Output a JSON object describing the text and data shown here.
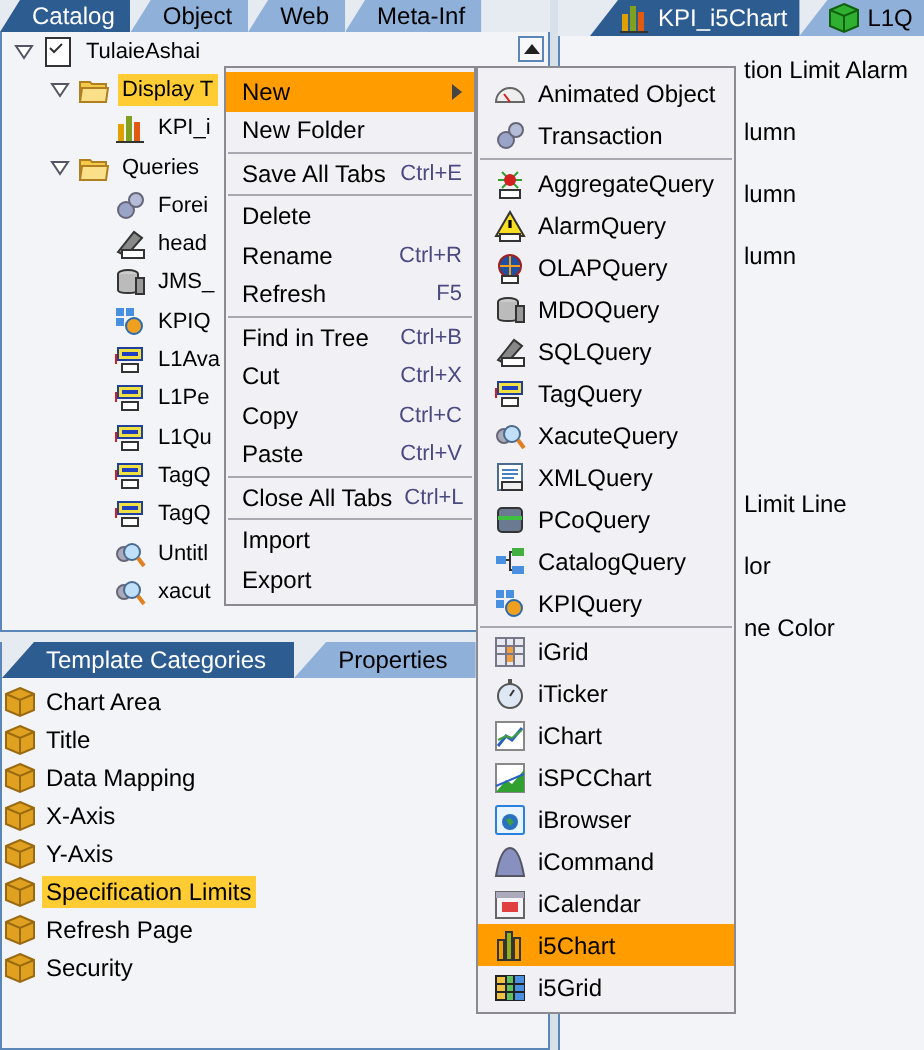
{
  "catalog_tabs": [
    {
      "label": "Catalog",
      "selected": true
    },
    {
      "label": "Object",
      "selected": false
    },
    {
      "label": "Web",
      "selected": false
    },
    {
      "label": "Meta-Inf",
      "selected": false
    }
  ],
  "tree": [
    {
      "label": "TulaieAshai",
      "expanded": true,
      "selected": false,
      "children": [
        {
          "label": "Display T",
          "expanded": true,
          "selected": true,
          "children": [
            {
              "label": "KPI_i",
              "selected": false
            }
          ]
        },
        {
          "label": "Queries",
          "expanded": true,
          "selected": false,
          "children": [
            {
              "label": "Forei",
              "selected": false
            },
            {
              "label": "head",
              "selected": false
            },
            {
              "label": "JMS_",
              "selected": false
            },
            {
              "label": "KPIQ",
              "selected": false
            },
            {
              "label": "L1Ava",
              "selected": false
            },
            {
              "label": "L1Pe",
              "selected": false
            },
            {
              "label": "L1Qu",
              "selected": false
            },
            {
              "label": "TagQ",
              "selected": false
            },
            {
              "label": "TagQ",
              "selected": false
            },
            {
              "label": "Untitl",
              "selected": false
            },
            {
              "label": "xacut",
              "selected": false
            }
          ]
        }
      ]
    }
  ],
  "category_tabs": [
    {
      "label": "Template Categories",
      "selected": true
    },
    {
      "label": "Properties",
      "selected": false
    }
  ],
  "categories": [
    {
      "label": "Chart Area",
      "selected": false
    },
    {
      "label": "Title",
      "selected": false
    },
    {
      "label": "Data Mapping",
      "selected": false
    },
    {
      "label": "X-Axis",
      "selected": false
    },
    {
      "label": "Y-Axis",
      "selected": false
    },
    {
      "label": "Specification Limits",
      "selected": true
    },
    {
      "label": "Refresh Page",
      "selected": false
    },
    {
      "label": "Security",
      "selected": false
    }
  ],
  "editor_tabs": [
    {
      "label": "KPI_i5Chart",
      "selected": true
    },
    {
      "label": "L1Q",
      "selected": false
    }
  ],
  "editor_lines": [
    "tion Limit Alarm",
    "lumn",
    "lumn",
    "lumn",
    "Limit Line",
    "lor",
    "ne Color"
  ],
  "context_menu": [
    {
      "kind": "item",
      "label": "New",
      "selected": true,
      "submenu": true
    },
    {
      "kind": "item",
      "label": "New Folder",
      "selected": false
    },
    {
      "kind": "separator"
    },
    {
      "kind": "item",
      "label": "Save All Tabs",
      "shortcut": "Ctrl+E",
      "selected": false
    },
    {
      "kind": "separator"
    },
    {
      "kind": "item",
      "label": "Delete",
      "selected": false
    },
    {
      "kind": "item",
      "label": "Rename",
      "shortcut": "Ctrl+R",
      "selected": false
    },
    {
      "kind": "item",
      "label": "Refresh",
      "shortcut": "F5",
      "selected": false
    },
    {
      "kind": "separator"
    },
    {
      "kind": "item",
      "label": "Find in Tree",
      "shortcut": "Ctrl+B",
      "selected": false
    },
    {
      "kind": "item",
      "label": "Cut",
      "shortcut": "Ctrl+X",
      "selected": false
    },
    {
      "kind": "item",
      "label": "Copy",
      "shortcut": "Ctrl+C",
      "selected": false
    },
    {
      "kind": "item",
      "label": "Paste",
      "shortcut": "Ctrl+V",
      "selected": false
    },
    {
      "kind": "separator"
    },
    {
      "kind": "item",
      "label": "Close All Tabs",
      "shortcut": "Ctrl+L",
      "selected": false
    },
    {
      "kind": "separator"
    },
    {
      "kind": "item",
      "label": "Import",
      "selected": false
    },
    {
      "kind": "item",
      "label": "Export",
      "selected": false
    }
  ],
  "new_submenu": [
    {
      "kind": "item",
      "label": "Animated Object",
      "selected": false
    },
    {
      "kind": "item",
      "label": "Transaction",
      "selected": false
    },
    {
      "kind": "separator"
    },
    {
      "kind": "item",
      "label": "AggregateQuery",
      "selected": false
    },
    {
      "kind": "item",
      "label": "AlarmQuery",
      "selected": false
    },
    {
      "kind": "item",
      "label": "OLAPQuery",
      "selected": false
    },
    {
      "kind": "item",
      "label": "MDOQuery",
      "selected": false
    },
    {
      "kind": "item",
      "label": "SQLQuery",
      "selected": false
    },
    {
      "kind": "item",
      "label": "TagQuery",
      "selected": false
    },
    {
      "kind": "item",
      "label": "XacuteQuery",
      "selected": false
    },
    {
      "kind": "item",
      "label": "XMLQuery",
      "selected": false
    },
    {
      "kind": "item",
      "label": "PCoQuery",
      "selected": false
    },
    {
      "kind": "item",
      "label": "CatalogQuery",
      "selected": false
    },
    {
      "kind": "item",
      "label": "KPIQuery",
      "selected": false
    },
    {
      "kind": "separator"
    },
    {
      "kind": "item",
      "label": "iGrid",
      "selected": false
    },
    {
      "kind": "item",
      "label": "iTicker",
      "selected": false
    },
    {
      "kind": "item",
      "label": "iChart",
      "selected": false
    },
    {
      "kind": "item",
      "label": "iSPCChart",
      "selected": false
    },
    {
      "kind": "item",
      "label": "iBrowser",
      "selected": false
    },
    {
      "kind": "item",
      "label": "iCommand",
      "selected": false
    },
    {
      "kind": "item",
      "label": "iCalendar",
      "selected": false
    },
    {
      "kind": "item",
      "label": "i5Chart",
      "selected": true
    },
    {
      "kind": "item",
      "label": "i5Grid",
      "selected": false
    }
  ]
}
